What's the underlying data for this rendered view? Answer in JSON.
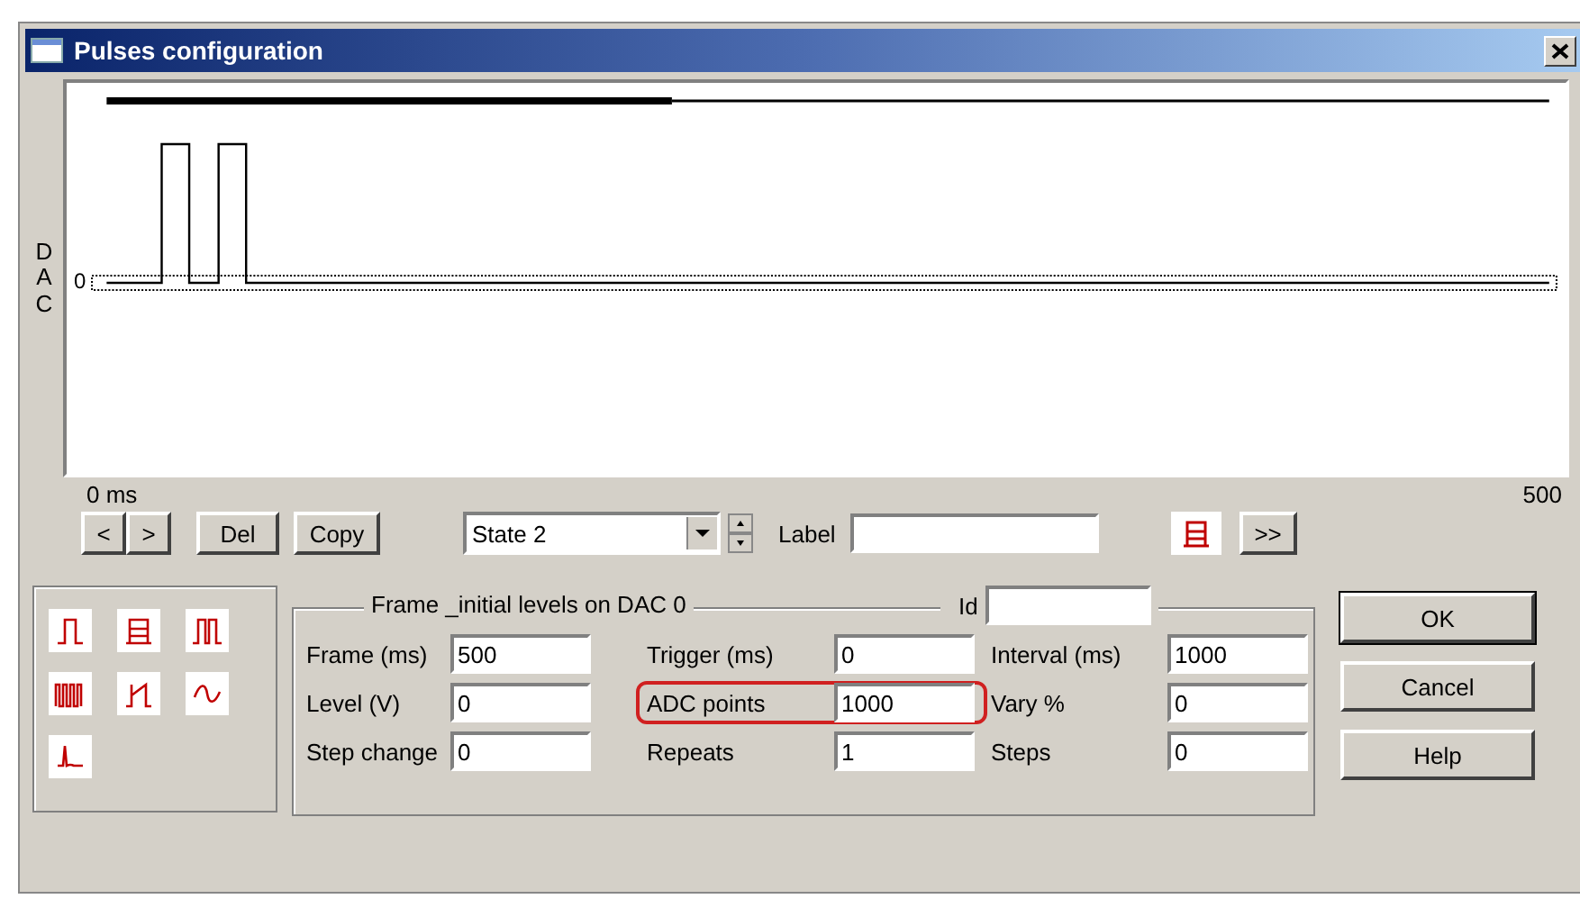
{
  "window": {
    "title": "Pulses configuration"
  },
  "plot": {
    "y_label": "DAC",
    "zero_label": "0",
    "x_start": "0 ms",
    "x_end": "500"
  },
  "nav_buttons": [
    "<",
    ">",
    "Del",
    "Copy"
  ],
  "state_select": {
    "value": "State 2"
  },
  "label_field": {
    "label": "Label"
  },
  "next_button": ">>",
  "frame_group": {
    "title": "Frame _initial levels on DAC 0",
    "id_label": "Id",
    "fields": [
      {
        "label": "Frame (ms)",
        "value": "500",
        "highlighted": false
      },
      {
        "label": "Trigger (ms)",
        "value": "0",
        "highlighted": false
      },
      {
        "label": "Interval (ms)",
        "value": "1000",
        "highlighted": false
      },
      {
        "label": "Level (V)",
        "value": "0",
        "highlighted": false
      },
      {
        "label": "ADC points",
        "value": "1000",
        "highlighted": true
      },
      {
        "label": "Vary %",
        "value": "0",
        "highlighted": false
      },
      {
        "label": "Step change",
        "value": "0",
        "highlighted": false
      },
      {
        "label": "Repeats",
        "value": "1",
        "highlighted": false
      },
      {
        "label": "Steps",
        "value": "0",
        "highlighted": false
      }
    ]
  },
  "buttons": [
    {
      "label": "OK",
      "default": true
    },
    {
      "label": "Cancel",
      "default": false
    },
    {
      "label": "Help",
      "default": false
    }
  ]
}
